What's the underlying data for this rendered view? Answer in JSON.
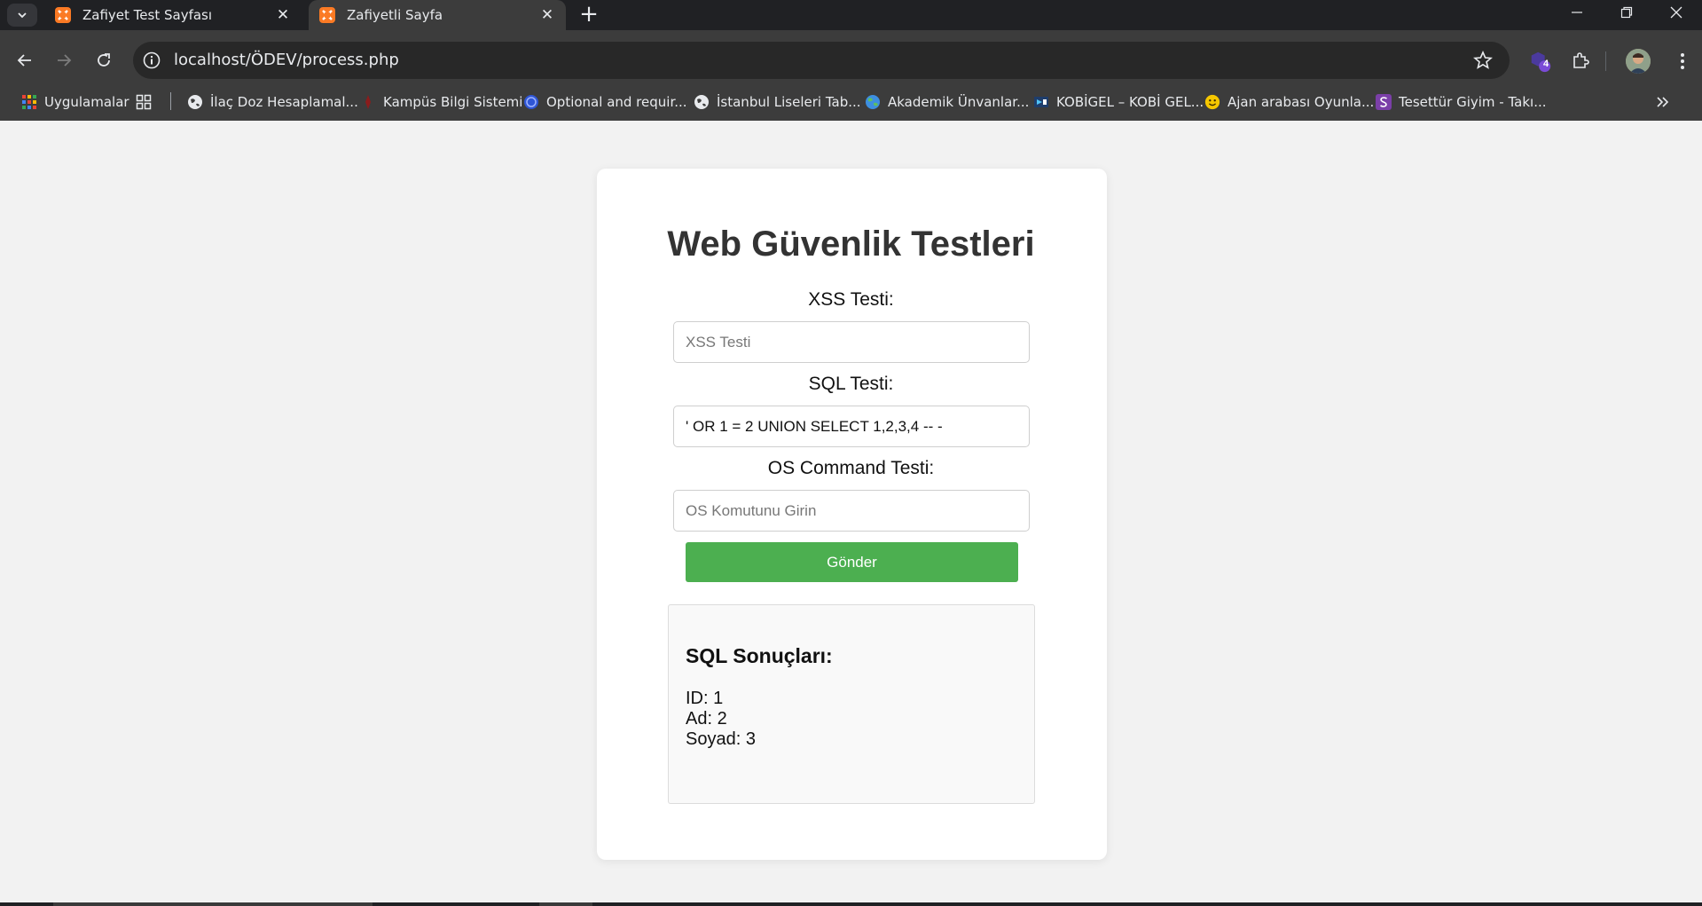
{
  "browser": {
    "tabs": [
      {
        "title": "Zafiyet Test Sayfası",
        "active": false
      },
      {
        "title": "Zafiyetli Sayfa",
        "active": true
      }
    ],
    "url": "localhost/ÖDEV/process.php",
    "extension_badge": "4",
    "bookmarks": [
      {
        "label": "Uygulamalar",
        "icon": "apps-grid-icon"
      },
      {
        "label": "İlaç Doz Hesaplamal...",
        "icon": "globe-icon"
      },
      {
        "label": "Kampüs Bilgi Sistemi",
        "icon": "university-logo-icon"
      },
      {
        "label": "Optional and requir...",
        "icon": "circle-logo-icon"
      },
      {
        "label": "İstanbul Liseleri Tab...",
        "icon": "globe-icon"
      },
      {
        "label": "Akademik Ünvanlar...",
        "icon": "earth-icon"
      },
      {
        "label": "KOBİGEL – KOBİ GEL...",
        "icon": "kobigel-logo-icon"
      },
      {
        "label": "Ajan arabası Oyunla...",
        "icon": "smiley-icon"
      },
      {
        "label": "Tesettür Giyim - Takı...",
        "icon": "s-logo-icon"
      }
    ]
  },
  "page": {
    "title": "Web Güvenlik Testleri",
    "xss": {
      "label": "XSS Testi:",
      "placeholder": "XSS Testi",
      "value": ""
    },
    "sql": {
      "label": "SQL Testi:",
      "placeholder": "",
      "value": "' OR 1 = 2 UNION SELECT 1,2,3,4 -- -"
    },
    "os": {
      "label": "OS Command Testi:",
      "placeholder": "OS Komutunu Girin",
      "value": ""
    },
    "submit_label": "Gönder",
    "results": {
      "heading": "SQL Sonuçları:",
      "rows": [
        "ID: 1",
        "Ad: 2",
        "Soyad: 3"
      ]
    }
  },
  "colors": {
    "submit_bg": "#4caf50",
    "chrome_dark": "#202124",
    "toolbar": "#3c3c3c"
  }
}
